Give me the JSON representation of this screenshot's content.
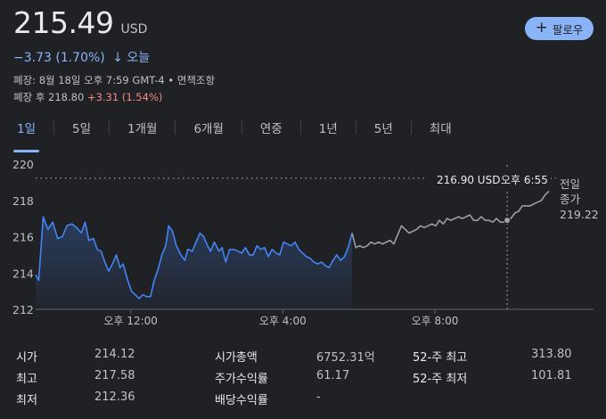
{
  "quote": {
    "price": "215.49",
    "currency": "USD",
    "change_text": "−3.73 (1.70%)",
    "change_arrow": "↓",
    "period": "오늘",
    "market_close": "폐장: 8월 18일 오후 7:59 GMT-4 • 면책조항",
    "after_hours_label": "폐장 후 218.80",
    "after_hours_change": "+3.31 (1.54%)"
  },
  "follow_button": {
    "label": "팔로우"
  },
  "tabs": [
    "1일",
    "5일",
    "1개월",
    "6개월",
    "연중",
    "1년",
    "5년",
    "최대"
  ],
  "active_tab": 0,
  "tooltip": {
    "price": "216.90 USD",
    "time": "오후 6:55"
  },
  "prev_close_label": [
    "전일",
    "종가",
    "219.22"
  ],
  "chart_data": {
    "type": "line",
    "title": "",
    "ylim": [
      212,
      220
    ],
    "yticks": [
      212,
      214,
      216,
      218,
      220
    ],
    "x_range_hours": [
      9.5,
      20.0
    ],
    "xtick_labels": [
      {
        "label": "오후 12:00",
        "hour": 12
      },
      {
        "label": "오후 4:00",
        "hour": 16
      },
      {
        "label": "오후 8:00",
        "hour": 20
      }
    ],
    "previous_close": 219.22,
    "grid": false,
    "series": [
      {
        "points": [
          [
            9.5,
            213.9
          ],
          [
            9.58,
            213.6
          ],
          [
            9.7,
            217.1
          ],
          [
            9.82,
            216.4
          ],
          [
            9.95,
            216.8
          ],
          [
            10.08,
            215.9
          ],
          [
            10.2,
            216.0
          ],
          [
            10.32,
            216.6
          ],
          [
            10.45,
            216.7
          ],
          [
            10.58,
            216.5
          ],
          [
            10.7,
            216.2
          ],
          [
            10.8,
            216.8
          ],
          [
            10.9,
            215.8
          ],
          [
            11.02,
            215.9
          ],
          [
            11.12,
            215.3
          ],
          [
            11.22,
            215.2
          ],
          [
            11.32,
            214.6
          ],
          [
            11.42,
            214.1
          ],
          [
            11.52,
            214.5
          ],
          [
            11.62,
            215.0
          ],
          [
            11.72,
            214.3
          ],
          [
            11.8,
            214.5
          ],
          [
            11.92,
            213.6
          ],
          [
            12.02,
            213.0
          ],
          [
            12.12,
            212.8
          ],
          [
            12.22,
            212.6
          ],
          [
            12.32,
            212.8
          ],
          [
            12.42,
            212.7
          ],
          [
            12.52,
            212.7
          ],
          [
            12.62,
            213.6
          ],
          [
            12.72,
            214.2
          ],
          [
            12.82,
            215.0
          ],
          [
            12.92,
            215.5
          ],
          [
            13.0,
            216.6
          ],
          [
            13.1,
            216.3
          ],
          [
            13.2,
            215.5
          ],
          [
            13.32,
            215.0
          ],
          [
            13.42,
            214.7
          ],
          [
            13.5,
            215.3
          ],
          [
            13.62,
            215.2
          ],
          [
            13.72,
            215.7
          ],
          [
            13.82,
            216.2
          ],
          [
            13.92,
            216.0
          ],
          [
            14.02,
            215.5
          ],
          [
            14.1,
            215.2
          ],
          [
            14.2,
            215.7
          ],
          [
            14.32,
            215.2
          ],
          [
            14.4,
            215.4
          ],
          [
            14.5,
            214.6
          ],
          [
            14.6,
            215.3
          ],
          [
            14.72,
            215.3
          ],
          [
            14.82,
            215.2
          ],
          [
            14.92,
            215.1
          ],
          [
            15.02,
            215.4
          ],
          [
            15.12,
            215.0
          ],
          [
            15.22,
            215.0
          ],
          [
            15.32,
            215.5
          ],
          [
            15.42,
            215.3
          ],
          [
            15.52,
            215.4
          ],
          [
            15.62,
            214.9
          ],
          [
            15.72,
            215.3
          ],
          [
            15.82,
            215.1
          ],
          [
            15.92,
            215.0
          ],
          [
            16.02,
            215.7
          ],
          [
            16.12,
            215.6
          ],
          [
            16.22,
            215.5
          ],
          [
            16.32,
            215.7
          ],
          [
            16.42,
            215.3
          ],
          [
            16.52,
            215.1
          ],
          [
            16.62,
            214.9
          ],
          [
            16.72,
            214.8
          ],
          [
            16.82,
            214.6
          ],
          [
            16.92,
            214.5
          ],
          [
            17.02,
            214.6
          ],
          [
            17.12,
            214.4
          ],
          [
            17.22,
            214.3
          ],
          [
            17.32,
            214.7
          ],
          [
            17.42,
            215.0
          ],
          [
            17.52,
            214.7
          ],
          [
            17.62,
            214.9
          ],
          [
            17.72,
            215.4
          ],
          [
            17.82,
            216.2
          ]
        ],
        "color": "#4285f4"
      },
      {
        "points": [
          [
            17.82,
            216.2
          ],
          [
            17.92,
            215.4
          ],
          [
            18.02,
            215.5
          ],
          [
            18.12,
            215.4
          ],
          [
            18.22,
            215.5
          ],
          [
            18.32,
            215.7
          ],
          [
            18.42,
            215.6
          ],
          [
            18.52,
            215.7
          ],
          [
            18.62,
            215.6
          ],
          [
            18.72,
            215.7
          ],
          [
            18.82,
            215.8
          ],
          [
            18.92,
            215.6
          ],
          [
            19.02,
            216.1
          ],
          [
            19.12,
            216.6
          ],
          [
            19.22,
            216.4
          ],
          [
            19.32,
            216.2
          ],
          [
            19.42,
            216.3
          ],
          [
            19.52,
            216.4
          ],
          [
            19.62,
            216.6
          ],
          [
            19.72,
            216.5
          ],
          [
            19.82,
            216.6
          ],
          [
            19.92,
            216.7
          ],
          [
            20.02,
            216.6
          ],
          [
            20.12,
            216.9
          ],
          [
            20.22,
            216.7
          ],
          [
            20.32,
            217.0
          ],
          [
            20.42,
            216.9
          ],
          [
            20.52,
            217.0
          ],
          [
            20.62,
            217.1
          ],
          [
            20.72,
            217.0
          ],
          [
            20.82,
            217.1
          ],
          [
            20.92,
            217.2
          ],
          [
            21.02,
            216.9
          ],
          [
            21.12,
            216.9
          ],
          [
            21.22,
            217.1
          ],
          [
            21.32,
            216.9
          ],
          [
            21.42,
            216.9
          ],
          [
            21.52,
            216.8
          ],
          [
            21.62,
            217.0
          ],
          [
            21.72,
            216.8
          ],
          [
            21.82,
            216.8
          ],
          [
            21.9,
            216.9
          ],
          [
            22.0,
            217.0
          ],
          [
            22.1,
            217.3
          ],
          [
            22.2,
            217.4
          ],
          [
            22.3,
            217.7
          ],
          [
            22.4,
            217.7
          ],
          [
            22.5,
            217.7
          ],
          [
            22.6,
            217.8
          ],
          [
            22.7,
            217.9
          ],
          [
            22.8,
            218.0
          ],
          [
            22.9,
            218.3
          ],
          [
            23.0,
            218.5
          ]
        ],
        "color": "#9aa0a6"
      }
    ],
    "tooltip_x_hour": 21.9
  },
  "stats": [
    [
      {
        "label": "시가",
        "value": "214.12"
      },
      {
        "label": "시가총액",
        "value": "6752.31억"
      },
      {
        "label": "52-주 최고",
        "value": "313.80"
      }
    ],
    [
      {
        "label": "최고",
        "value": "217.58"
      },
      {
        "label": "주가수익률",
        "value": "61.17"
      },
      {
        "label": "52-주 최저",
        "value": "101.81"
      }
    ],
    [
      {
        "label": "최저",
        "value": "212.36"
      },
      {
        "label": "배당수익률",
        "value": "-"
      },
      {
        "label": "",
        "value": ""
      }
    ]
  ]
}
